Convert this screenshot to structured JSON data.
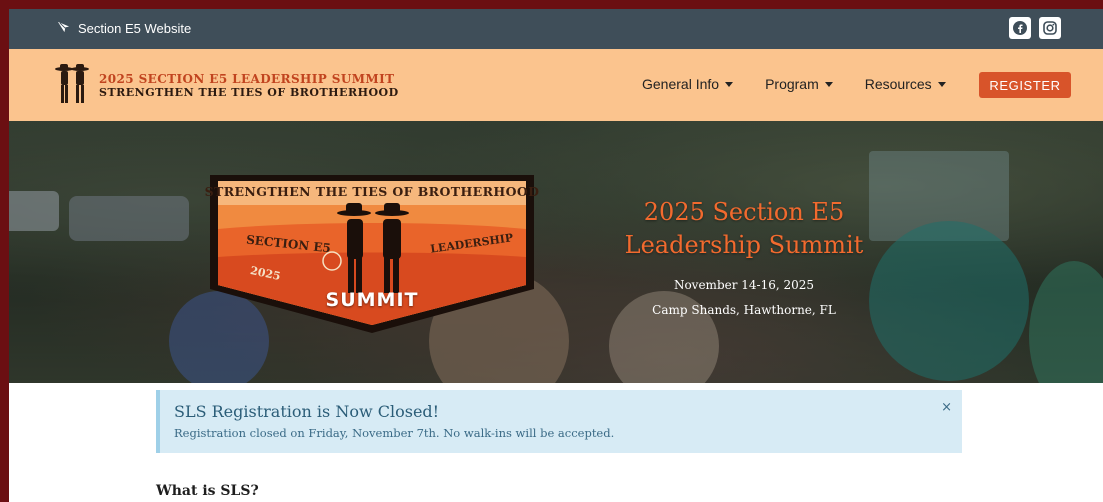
{
  "topbar": {
    "site_link": "Section E5 Website",
    "social": [
      "facebook-icon",
      "instagram-icon"
    ]
  },
  "logo": {
    "line1": "2025 SECTION E5 LEADERSHIP SUMMIT",
    "line2": "STRENGTHEN THE TIES OF BROTHERHOOD"
  },
  "nav": {
    "items": [
      {
        "label": "General Info"
      },
      {
        "label": "Program"
      },
      {
        "label": "Resources"
      }
    ],
    "register_label": "REGISTER"
  },
  "hero": {
    "badge": {
      "top": "STRENGTHEN THE TIES OF BROTHERHOOD",
      "section": "SECTION E5",
      "leadership": "LEADERSHIP",
      "year": "2025",
      "summit": "SUMMIT"
    },
    "title": "2025 Section E5 Leadership Summit",
    "dates": "November 14-16, 2025",
    "location": "Camp Shands, Hawthorne, FL"
  },
  "alert": {
    "title": "SLS Registration is Now Closed!",
    "body": "Registration closed on Friday, November 7th. No walk-ins will be accepted.",
    "close": "×"
  },
  "content": {
    "heading": "What is SLS?"
  },
  "colors": {
    "topbar": "#3f4e59",
    "navbar": "#fbc48e",
    "accent": "#d8542a",
    "hero_title": "#f26a2e",
    "alert_bg": "#d7ebf5",
    "page_border": "#6b0f12"
  }
}
